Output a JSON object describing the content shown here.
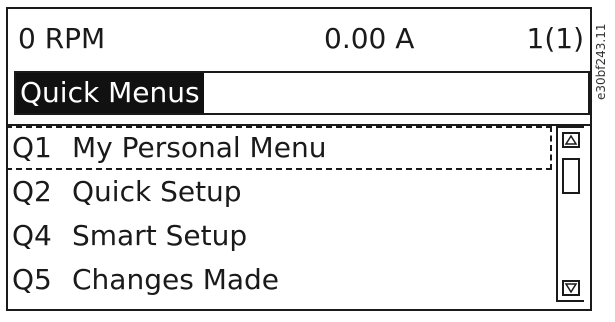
{
  "status": {
    "speed": "0 RPM",
    "current": "0.00 A",
    "page": "1(1)"
  },
  "title": "Quick Menus",
  "menu": [
    {
      "code": "Q1",
      "label": "My Personal Menu",
      "selected": true
    },
    {
      "code": "Q2",
      "label": "Quick Setup",
      "selected": false
    },
    {
      "code": "Q4",
      "label": "Smart Setup",
      "selected": false
    },
    {
      "code": "Q5",
      "label": "Changes Made",
      "selected": false
    }
  ],
  "scrollbar": {
    "up_icon": "triangle-up-icon",
    "down_icon": "triangle-down-icon"
  },
  "figure_code": "e30bf243.11",
  "colors": {
    "ink": "#1a1a1a",
    "highlight": "#111111",
    "background": "#ffffff"
  }
}
